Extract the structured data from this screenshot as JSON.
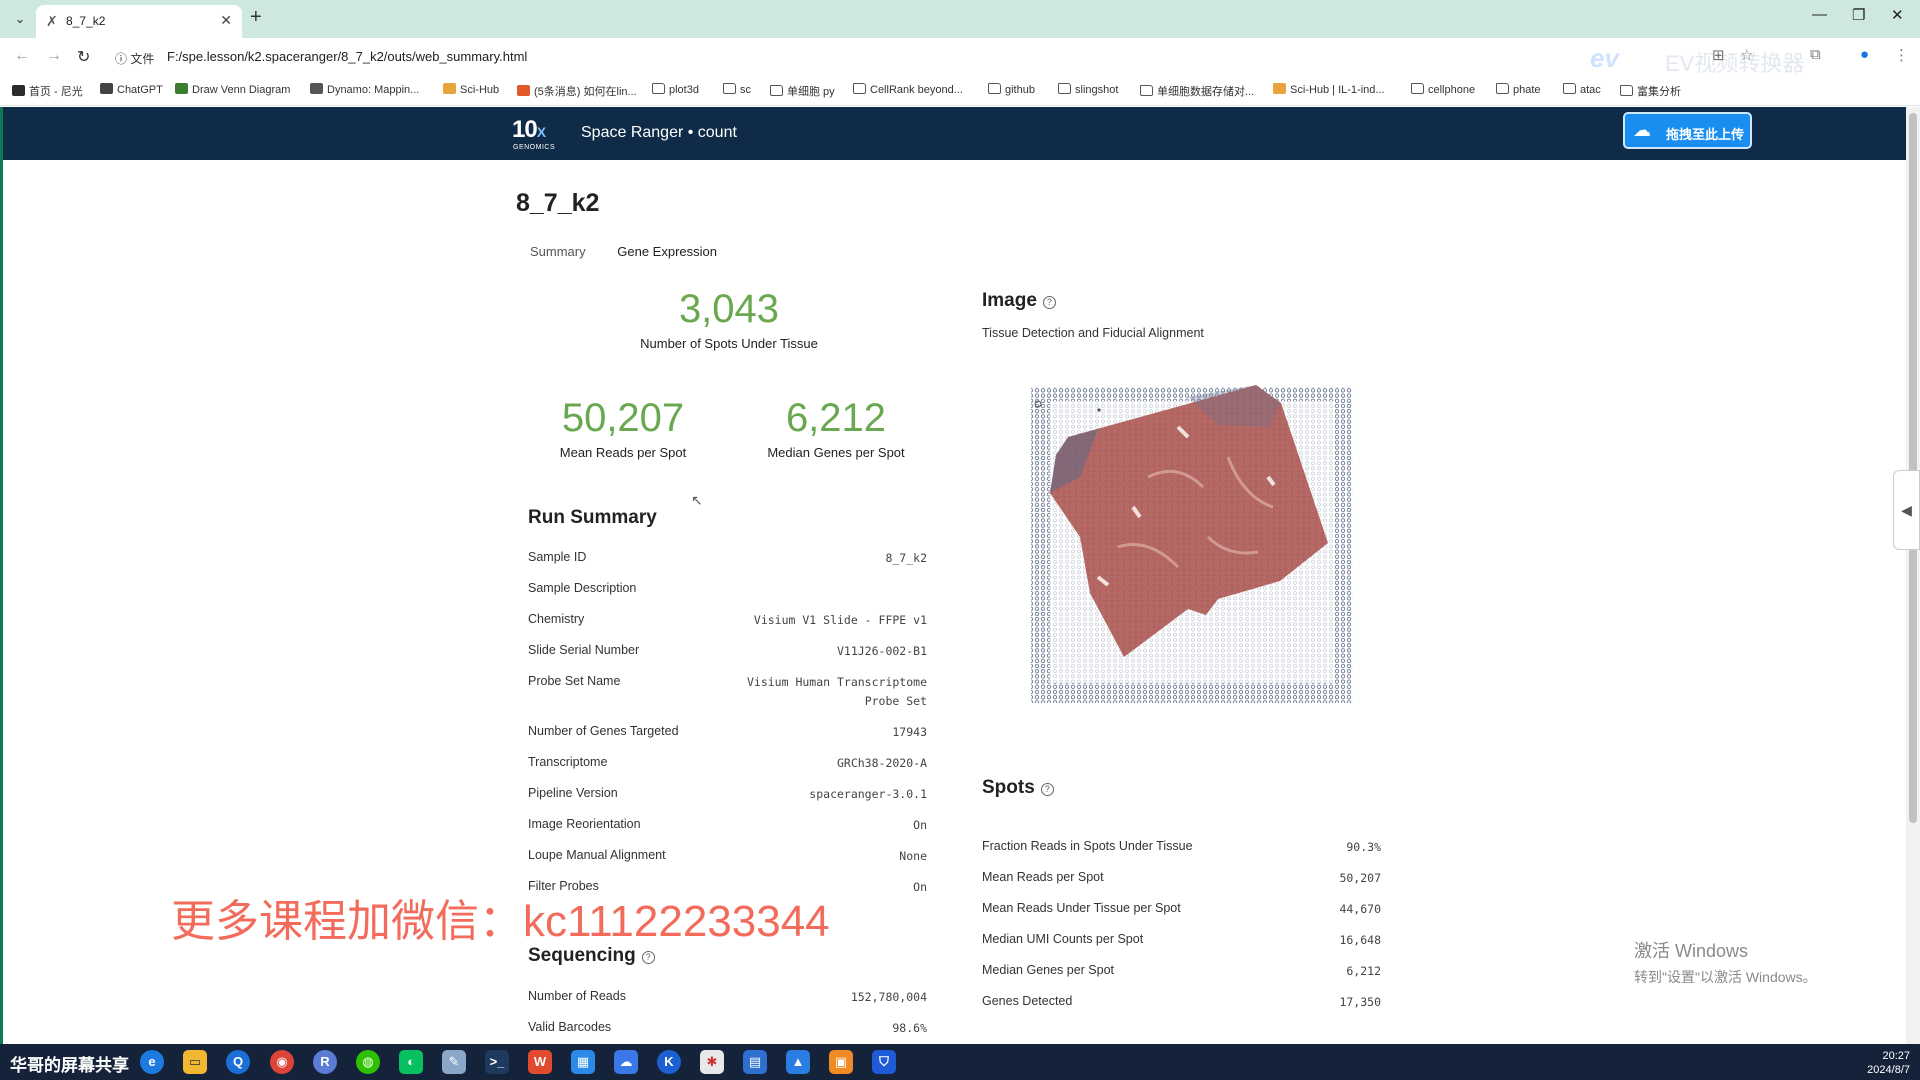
{
  "browser": {
    "tab_title": "8_7_k2",
    "site_info": "文件",
    "url": "F:/spe.lesson/k2.spaceranger/8_7_k2/outs/web_summary.html",
    "ev_text": "EV视频转换器",
    "bookmarks": [
      {
        "label": "首页 - 尼光",
        "icon_color": "#2b2b2b"
      },
      {
        "label": "ChatGPT",
        "icon_color": "#444444"
      },
      {
        "label": "Draw Venn Diagram",
        "icon_color": "#3a7d2e"
      },
      {
        "label": "Dynamo: Mappin...",
        "icon_color": "#555555"
      },
      {
        "label": "Sci-Hub",
        "icon_color": "#e8a33c"
      },
      {
        "label": "(5条消息) 如何在lin...",
        "icon_color": "#e05a2b"
      },
      {
        "label": "plot3d",
        "icon_color": "folder"
      },
      {
        "label": "sc",
        "icon_color": "folder"
      },
      {
        "label": "单细胞 py",
        "icon_color": "folder"
      },
      {
        "label": "CellRank beyond...",
        "icon_color": "folder"
      },
      {
        "label": "github",
        "icon_color": "folder"
      },
      {
        "label": "slingshot",
        "icon_color": "folder"
      },
      {
        "label": "单细胞数据存储对...",
        "icon_color": "folder"
      },
      {
        "label": "Sci-Hub | IL-1-ind...",
        "icon_color": "#e8a33c"
      },
      {
        "label": "cellphone",
        "icon_color": "folder"
      },
      {
        "label": "phate",
        "icon_color": "folder"
      },
      {
        "label": "atac",
        "icon_color": "folder"
      },
      {
        "label": "富集分析",
        "icon_color": "folder"
      }
    ]
  },
  "header": {
    "logo_main": "10",
    "logo_x": "X",
    "logo_sub": "GENOMICS",
    "product": "Space Ranger • count",
    "upload_label": "拖拽至此上传"
  },
  "page": {
    "sample_title": "8_7_k2",
    "tabs": [
      "Summary",
      "Gene Expression"
    ],
    "metrics": {
      "spots_val": "3,043",
      "spots_lbl": "Number of Spots Under Tissue",
      "reads_val": "50,207",
      "reads_lbl": "Mean Reads per Spot",
      "genes_val": "6,212",
      "genes_lbl": "Median Genes per Spot"
    },
    "run_summary": {
      "title": "Run Summary",
      "rows": [
        {
          "label": "Sample ID",
          "value": "8_7_k2"
        },
        {
          "label": "Sample Description",
          "value": ""
        },
        {
          "label": "Chemistry",
          "value": "Visium V1 Slide - FFPE v1"
        },
        {
          "label": "Slide Serial Number",
          "value": "V11J26-002-B1"
        },
        {
          "label": "Probe Set Name",
          "value": "Visium Human Transcriptome Probe Set"
        },
        {
          "label": "Number of Genes Targeted",
          "value": "17943"
        },
        {
          "label": "Transcriptome",
          "value": "GRCh38-2020-A"
        },
        {
          "label": "Pipeline Version",
          "value": "spaceranger-3.0.1"
        },
        {
          "label": "Image Reorientation",
          "value": "On"
        },
        {
          "label": "Loupe Manual Alignment",
          "value": "None"
        },
        {
          "label": "Filter Probes",
          "value": "On"
        }
      ]
    },
    "sequencing": {
      "title": "Sequencing",
      "rows": [
        {
          "label": "Number of Reads",
          "value": "152,780,004"
        },
        {
          "label": "Valid Barcodes",
          "value": "98.6%"
        }
      ]
    },
    "image": {
      "title": "Image",
      "subtitle": "Tissue Detection and Fiducial Alignment"
    },
    "spots": {
      "title": "Spots",
      "rows": [
        {
          "label": "Fraction Reads in Spots Under Tissue",
          "value": "90.3%"
        },
        {
          "label": "Mean Reads per Spot",
          "value": "50,207"
        },
        {
          "label": "Mean Reads Under Tissue per Spot",
          "value": "44,670"
        },
        {
          "label": "Median UMI Counts per Spot",
          "value": "16,648"
        },
        {
          "label": "Median Genes per Spot",
          "value": "6,212"
        },
        {
          "label": "Genes Detected",
          "value": "17,350"
        }
      ]
    }
  },
  "overlays": {
    "watermark": "更多课程加微信：kc11122233344",
    "activate_title": "激活 Windows",
    "activate_sub": "转到\"设置\"以激活 Windows。"
  },
  "taskbar": {
    "share_label": "华哥的屏幕共享",
    "time": "20:27",
    "date": "2024/8/7"
  },
  "colors": {
    "header_bg": "#0f2b47",
    "metric_green": "#6aa84f",
    "tab_bar": "#cfe8de",
    "tissue": "#b5615c"
  }
}
